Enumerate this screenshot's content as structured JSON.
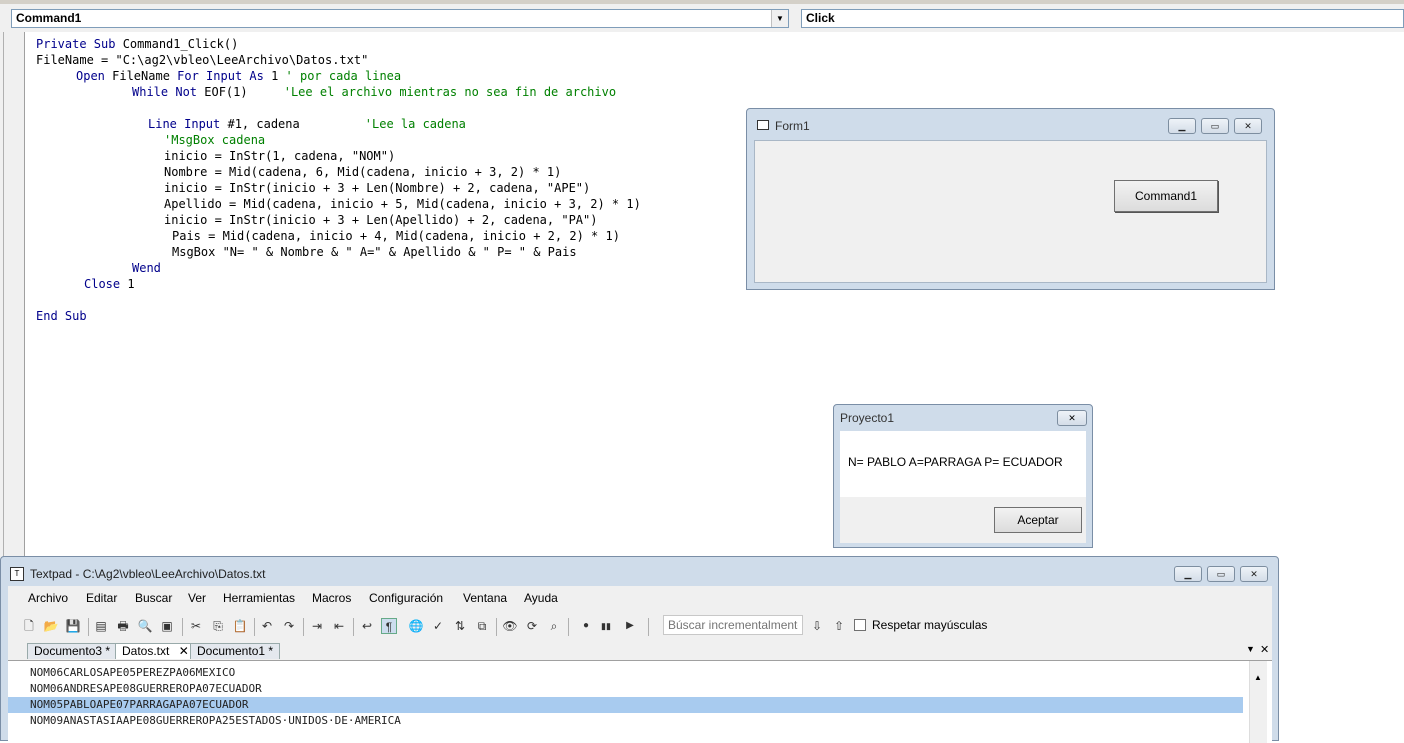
{
  "ide": {
    "object_combo": "Command1",
    "proc_combo": "Click",
    "code_lines": [
      {
        "indent": 36,
        "parts": [
          {
            "t": "kw",
            "s": "Private Sub "
          },
          {
            "t": "tx",
            "s": "Command1_Click()"
          }
        ]
      },
      {
        "indent": 36,
        "parts": [
          {
            "t": "tx",
            "s": "FileName = \"C:\\ag2\\vbleo\\LeeArchivo\\Datos.txt\""
          }
        ]
      },
      {
        "indent": 76,
        "parts": [
          {
            "t": "kw",
            "s": "Open "
          },
          {
            "t": "tx",
            "s": "FileName "
          },
          {
            "t": "kw",
            "s": "For Input As "
          },
          {
            "t": "tx",
            "s": "1 "
          },
          {
            "t": "cm",
            "s": "' por cada linea"
          }
        ]
      },
      {
        "indent": 132,
        "parts": [
          {
            "t": "kw",
            "s": "While Not "
          },
          {
            "t": "tx",
            "s": "EOF(1)     "
          },
          {
            "t": "cm",
            "s": "'Lee el archivo mientras no sea fin de archivo"
          }
        ]
      },
      {
        "indent": 0,
        "parts": []
      },
      {
        "indent": 148,
        "parts": [
          {
            "t": "kw",
            "s": "Line Input "
          },
          {
            "t": "tx",
            "s": "#1, cadena         "
          },
          {
            "t": "cm",
            "s": "'Lee la cadena"
          }
        ]
      },
      {
        "indent": 164,
        "parts": [
          {
            "t": "cm",
            "s": "'MsgBox cadena"
          }
        ]
      },
      {
        "indent": 164,
        "parts": [
          {
            "t": "tx",
            "s": "inicio = InStr(1, cadena, \"NOM\")"
          }
        ]
      },
      {
        "indent": 164,
        "parts": [
          {
            "t": "tx",
            "s": "Nombre = Mid(cadena, 6, Mid(cadena, inicio + 3, 2) * 1)"
          }
        ]
      },
      {
        "indent": 164,
        "parts": [
          {
            "t": "tx",
            "s": "inicio = InStr(inicio + 3 + Len(Nombre) + 2, cadena, \"APE\")"
          }
        ]
      },
      {
        "indent": 164,
        "parts": [
          {
            "t": "tx",
            "s": "Apellido = Mid(cadena, inicio + 5, Mid(cadena, inicio + 3, 2) * 1)"
          }
        ]
      },
      {
        "indent": 164,
        "parts": [
          {
            "t": "tx",
            "s": "inicio = InStr(inicio + 3 + Len(Apellido) + 2, cadena, \"PA\")"
          }
        ]
      },
      {
        "indent": 172,
        "parts": [
          {
            "t": "tx",
            "s": "Pais = Mid(cadena, inicio + 4, Mid(cadena, inicio + 2, 2) * 1)"
          }
        ]
      },
      {
        "indent": 172,
        "parts": [
          {
            "t": "tx",
            "s": "MsgBox \"N= \" & Nombre & \" A=\" & Apellido & \" P= \" & Pais"
          }
        ]
      },
      {
        "indent": 132,
        "parts": [
          {
            "t": "kw",
            "s": "Wend"
          }
        ]
      },
      {
        "indent": 84,
        "parts": [
          {
            "t": "kw",
            "s": "Close "
          },
          {
            "t": "tx",
            "s": "1"
          }
        ]
      },
      {
        "indent": 0,
        "parts": []
      },
      {
        "indent": 36,
        "parts": [
          {
            "t": "kw",
            "s": "End Sub"
          }
        ]
      }
    ],
    "colors": {
      "keyword": "#00008b",
      "comment": "#008000",
      "text": "#000000"
    }
  },
  "form1": {
    "title": "Form1",
    "button_label": "Command1",
    "minimize_icon": "minimize-icon",
    "maximize_icon": "maximize-icon",
    "close_icon": "close-icon"
  },
  "msgbox": {
    "title": "Proyecto1",
    "message": "N= PABLO A=PARRAGA P= ECUADOR",
    "ok_label": "Aceptar"
  },
  "textpad": {
    "title": "Textpad - C:\\Ag2\\vbleo\\LeeArchivo\\Datos.txt",
    "menu": [
      "Archivo",
      "Editar",
      "Buscar",
      "Ver",
      "Herramientas",
      "Macros",
      "Configuración",
      "Ventana",
      "Ayuda"
    ],
    "search_placeholder": "Búscar incrementalmente",
    "case_label": "Respetar mayúsculas",
    "tabs": [
      {
        "label": "Documento3 *",
        "active": false
      },
      {
        "label": "Datos.txt",
        "active": true
      },
      {
        "label": "Documento1 *",
        "active": false
      }
    ],
    "lines": [
      {
        "text": "NOM06CARLOSAPE05PEREZPA06MEXICO",
        "selected": false
      },
      {
        "text": "NOM06ANDRESAPE08GUERREROPA07ECUADOR",
        "selected": false
      },
      {
        "text": "NOM05PABLOAPE07PARRAGAPA07ECUADOR",
        "selected": true
      },
      {
        "text": "NOM09ANASTASIAAPE08GUERREROPA25ESTADOS·UNIDOS·DE·AMERICA",
        "selected": false
      }
    ]
  }
}
